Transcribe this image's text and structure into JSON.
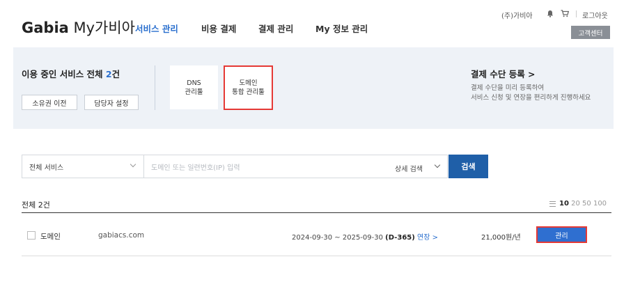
{
  "header": {
    "logo_brand": "Gabia",
    "logo_sub": "My가비아",
    "nav": [
      "서비스 관리",
      "비용 결제",
      "결제 관리",
      "My 정보 관리"
    ],
    "company": "(주)가비아",
    "logout": "로그아웃",
    "customer_center": "고객센터"
  },
  "banner": {
    "title_prefix": "이용 중인 서비스 전체 ",
    "count": "2",
    "title_suffix": "건",
    "transfer_btn": "소유권 이전",
    "manager_btn": "담당자 설정",
    "dns_line1": "DNS",
    "dns_line2": "관리툴",
    "domain_line1": "도메인",
    "domain_line2": "통합 관리툴",
    "pay_title": "결제 수단 등록 >",
    "pay_desc1": "결제 수단을 미리 등록하여",
    "pay_desc2": "서비스 신청 및 연장을 편리하게 진행하세요"
  },
  "search": {
    "select_value": "전체 서비스",
    "placeholder": "도메인 또는 일련번호(IP) 입력",
    "detail": "상세 검색",
    "button": "검색"
  },
  "list": {
    "total": "전체 2건",
    "page_sizes": [
      "10",
      "20",
      "50",
      "100"
    ],
    "rows": [
      {
        "type": "도메인",
        "name": "gabiacs.com",
        "period": "2024-09-30 ~ 2025-09-30",
        "dday": "(D-365)",
        "extend": "연장 >",
        "price": "21,000원/년",
        "manage": "관리"
      }
    ]
  },
  "colors": {
    "accent": "#2a6fce",
    "highlight": "#e53935",
    "search_btn": "#1f5fa8"
  }
}
